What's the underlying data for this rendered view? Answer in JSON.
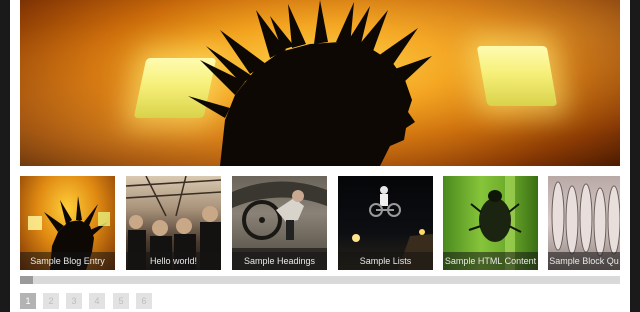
{
  "hero": {
    "image": "punk-silhouette-photo"
  },
  "thumbnails": [
    {
      "caption": "Sample Blog Entry",
      "image": "punk-silhouette"
    },
    {
      "caption": "Hello world!",
      "image": "band-photo"
    },
    {
      "caption": "Sample Headings",
      "image": "skater-bike"
    },
    {
      "caption": "Sample Lists",
      "image": "bmx-night-jump"
    },
    {
      "caption": "Sample HTML Content",
      "image": "beetle-leaf"
    },
    {
      "caption": "Sample Block Qu",
      "image": "fish-market"
    }
  ],
  "scrollbar": {
    "position_fraction": 0.0,
    "visible_fraction": 0.022
  },
  "pager": {
    "pages": [
      "1",
      "2",
      "3",
      "4",
      "5",
      "6"
    ],
    "active_index": 0
  },
  "colors": {
    "frame": "#1a1a1a",
    "hero_glow": "#f2a01a",
    "caption_bg": "#141414",
    "page_active": "#b3b3b3",
    "page_idle": "#e2e2e2"
  }
}
